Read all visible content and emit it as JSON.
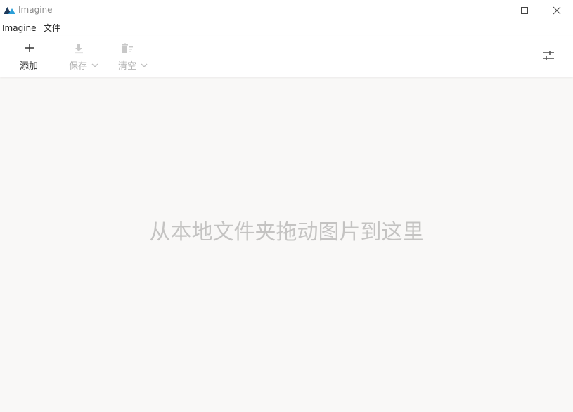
{
  "window": {
    "title": "Imagine",
    "controls": [
      "minimize-icon",
      "maximize-icon",
      "close-icon"
    ]
  },
  "menu": {
    "app": "Imagine",
    "file": "文件"
  },
  "toolbar": {
    "add_label": "添加",
    "add_icon": "plus-icon",
    "save_label": "保存",
    "save_icon": "download-icon",
    "save_enabled": false,
    "clear_label": "清空",
    "clear_icon": "clear-list-icon",
    "clear_enabled": false,
    "settings_icon": "sliders-icon"
  },
  "main": {
    "drop_hint": "从本地文件夹拖动图片到这里"
  },
  "colors": {
    "logo_dark": "#1e3b5c",
    "logo_accent": "#2b9fd8",
    "disabled_text": "#b5b5b5",
    "hint_text": "#c4c3c2",
    "background": "#f9f8f7"
  }
}
